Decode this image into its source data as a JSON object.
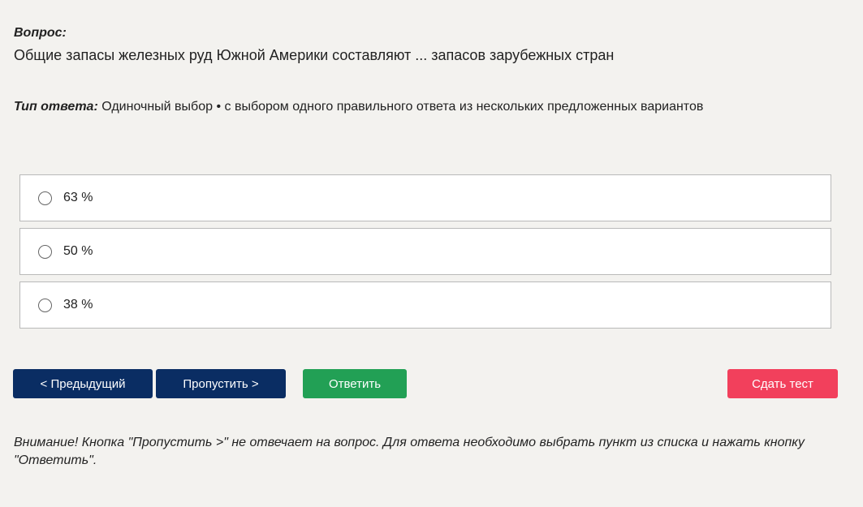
{
  "question": {
    "label": "Вопрос:",
    "text": "Общие запасы железных руд Южной Америки составляют ... запасов зарубежных стран"
  },
  "answer_type": {
    "label": "Тип ответа:",
    "value": "Одиночный выбор • с выбором одного правильного ответа из нескольких предложенных вариантов"
  },
  "options": [
    {
      "label": "63 %",
      "selected": false
    },
    {
      "label": "50 %",
      "selected": false
    },
    {
      "label": "38 %",
      "selected": false
    }
  ],
  "buttons": {
    "prev": "< Предыдущий",
    "skip": "Пропустить >",
    "answer": "Ответить",
    "submit": "Сдать тест"
  },
  "colors": {
    "background": "#f3f2ef",
    "nav_button": "#0a2d63",
    "answer_button": "#22a055",
    "submit_button": "#f2405c"
  },
  "note": "Внимание! Кнопка \"Пропустить >\" не отвечает на вопрос. Для ответа необходимо выбрать пункт из списка и нажать кнопку \"Ответить\"."
}
